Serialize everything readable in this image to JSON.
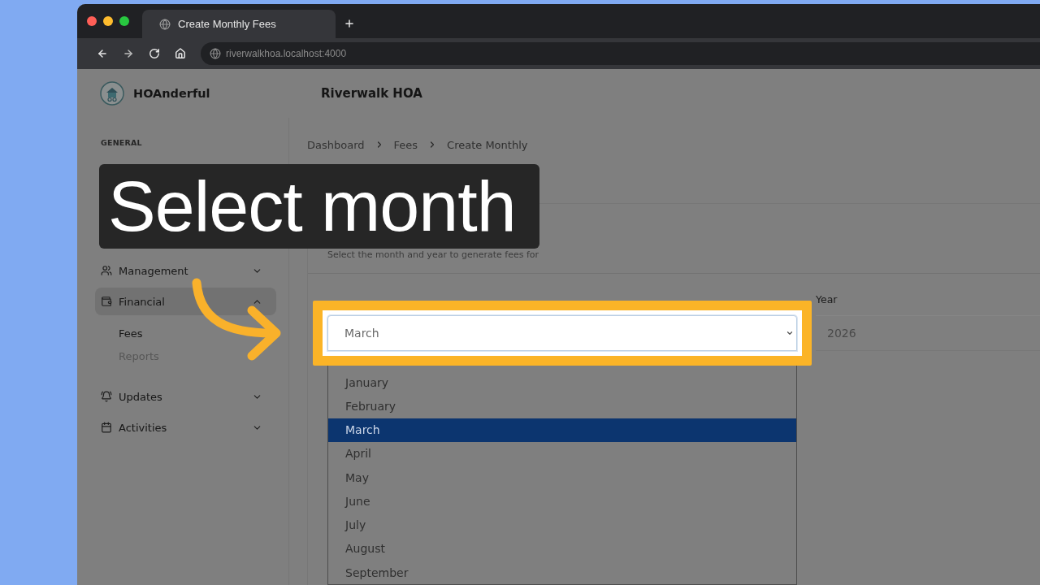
{
  "browser": {
    "tab_title": "Create Monthly Fees",
    "url": "riverwalkhoa.localhost:4000"
  },
  "header": {
    "brand": "HOAnderful",
    "organization": "Riverwalk HOA"
  },
  "sidebar": {
    "sections": [
      {
        "title": "GENERAL"
      },
      {
        "items": [
          {
            "label": "Management",
            "selected": false,
            "expanded": false
          },
          {
            "label": "Financial",
            "selected": true,
            "expanded": true,
            "children": [
              {
                "label": "Fees",
                "selected": true
              },
              {
                "label": "Reports",
                "selected": false
              }
            ]
          },
          {
            "label": "Updates",
            "selected": false,
            "expanded": false
          },
          {
            "label": "Activities",
            "selected": false,
            "expanded": false
          }
        ]
      }
    ]
  },
  "breadcrumb": [
    "Dashboard",
    "Fees",
    "Create Monthly"
  ],
  "fee_period": {
    "description": "Select the month and year to generate fees for",
    "month": {
      "value": "March",
      "open": true,
      "options": [
        {
          "label": "January",
          "selected": false
        },
        {
          "label": "February",
          "selected": false
        },
        {
          "label": "March",
          "selected": true
        },
        {
          "label": "April",
          "selected": false
        },
        {
          "label": "May",
          "selected": false
        },
        {
          "label": "June",
          "selected": false
        },
        {
          "label": "July",
          "selected": false
        },
        {
          "label": "August",
          "selected": false
        },
        {
          "label": "September",
          "selected": false
        }
      ]
    },
    "year": {
      "label": "Year",
      "value": "2026"
    }
  },
  "tutorial": {
    "caption": "Select month"
  }
}
